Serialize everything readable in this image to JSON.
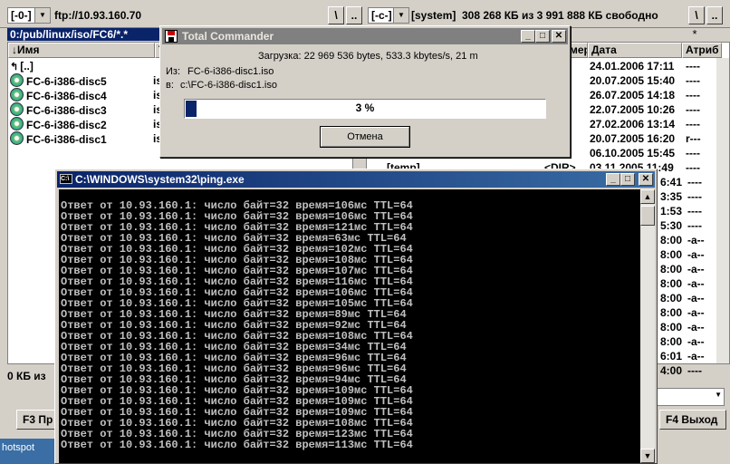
{
  "top_bar": {
    "left_drive": "[-0-]",
    "left_location": "ftp://10.93.160.70",
    "root_btn": "\\",
    "up_btn": "..",
    "right_drive": "[-c-]",
    "right_label": "[system]",
    "right_freespace": "308 268 КБ из 3 991 888 КБ свободно",
    "right_root_btn": "\\",
    "right_up_btn": ".."
  },
  "left_panel": {
    "path": "0:/pub/linux/iso/FC6/*.*",
    "columns": {
      "name": "↓Имя",
      "ext": "Т"
    },
    "items": [
      {
        "name": "[..]",
        "ext": ""
      },
      {
        "name": "FC-6-i386-disc5",
        "ext": "is"
      },
      {
        "name": "FC-6-i386-disc4",
        "ext": "is"
      },
      {
        "name": "FC-6-i386-disc3",
        "ext": "is"
      },
      {
        "name": "FC-6-i386-disc2",
        "ext": "is"
      },
      {
        "name": "FC-6-i386-disc1",
        "ext": "is"
      }
    ],
    "status": "0 КБ из"
  },
  "right_panel": {
    "star": "*",
    "columns": {
      "size": "мер",
      "date": "Дата",
      "attr": "Атриб"
    },
    "rows": [
      {
        "name": "",
        "size": ">",
        "date": "24.01.2006 17:11",
        "attr": "----"
      },
      {
        "name": "",
        "size": ">",
        "date": "20.07.2005 15:40",
        "attr": "----"
      },
      {
        "name": "",
        "size": ">",
        "date": "26.07.2005 14:18",
        "attr": "----"
      },
      {
        "name": "",
        "size": ">",
        "date": "22.07.2005 10:26",
        "attr": "----"
      },
      {
        "name": "",
        "size": ">",
        "date": "27.02.2006 13:14",
        "attr": "----"
      },
      {
        "name": "",
        "size": ">",
        "date": "20.07.2005 16:20",
        "attr": "r---"
      },
      {
        "name": "",
        "size": ">",
        "date": "06.10.2005 15:45",
        "attr": "----"
      },
      {
        "name": "[temp]",
        "size": "<DIR>",
        "date": "03.11.2005 11:49",
        "attr": "----"
      }
    ],
    "partial_times": [
      "6:41",
      "3:35",
      "1:53",
      "5:30",
      "8:00",
      "8:00",
      "8:00",
      "8:00",
      "8:00",
      "8:00",
      "8:00",
      "8:00",
      "6:01",
      "4:00"
    ],
    "partial_attrs": [
      "----",
      "----",
      "----",
      "----",
      "-a--",
      "-a--",
      "-a--",
      "-a--",
      "-a--",
      "-a--",
      "-a--",
      "-a--",
      "-a--",
      "----"
    ]
  },
  "function_keys": {
    "f3": "F3 Пр",
    "f8": "F4 Выход"
  },
  "dialog": {
    "title": "Total Commander",
    "download_text": "Загрузка: 22 969 536 bytes, 533.3 kbytes/s, 21 m",
    "from_label": "Из:",
    "from_value": "FC-6-i386-disc1.iso",
    "to_label": "в:",
    "to_value": "c:\\FC-6-i386-disc1.iso",
    "progress_text": "3 %",
    "progress_fraction": 0.03,
    "cancel_label": "Отмена"
  },
  "console": {
    "title": "C:\\WINDOWS\\system32\\ping.exe",
    "lines": [
      "Ответ от 10.93.160.1: число байт=32 время=106мс TTL=64",
      "Ответ от 10.93.160.1: число байт=32 время=106мс TTL=64",
      "Ответ от 10.93.160.1: число байт=32 время=121мс TTL=64",
      "Ответ от 10.93.160.1: число байт=32 время=63мс TTL=64",
      "Ответ от 10.93.160.1: число байт=32 время=102мс TTL=64",
      "Ответ от 10.93.160.1: число байт=32 время=108мс TTL=64",
      "Ответ от 10.93.160.1: число байт=32 время=107мс TTL=64",
      "Ответ от 10.93.160.1: число байт=32 время=116мс TTL=64",
      "Ответ от 10.93.160.1: число байт=32 время=106мс TTL=64",
      "Ответ от 10.93.160.1: число байт=32 время=105мс TTL=64",
      "Ответ от 10.93.160.1: число байт=32 время=89мс TTL=64",
      "Ответ от 10.93.160.1: число байт=32 время=92мс TTL=64",
      "Ответ от 10.93.160.1: число байт=32 время=108мс TTL=64",
      "Ответ от 10.93.160.1: число байт=32 время=34мс TTL=64",
      "Ответ от 10.93.160.1: число байт=32 время=96мс TTL=64",
      "Ответ от 10.93.160.1: число байт=32 время=96мс TTL=64",
      "Ответ от 10.93.160.1: число байт=32 время=94мс TTL=64",
      "Ответ от 10.93.160.1: число байт=32 время=109мс TTL=64",
      "Ответ от 10.93.160.1: число байт=32 время=109мс TTL=64",
      "Ответ от 10.93.160.1: число байт=32 время=109мс TTL=64",
      "Ответ от 10.93.160.1: число байт=32 время=108мс TTL=64",
      "Ответ от 10.93.160.1: число байт=32 время=123мс TTL=64",
      "Ответ от 10.93.160.1: число байт=32 время=113мс TTL=64"
    ]
  },
  "taskbar": {
    "label": "hotspot"
  }
}
